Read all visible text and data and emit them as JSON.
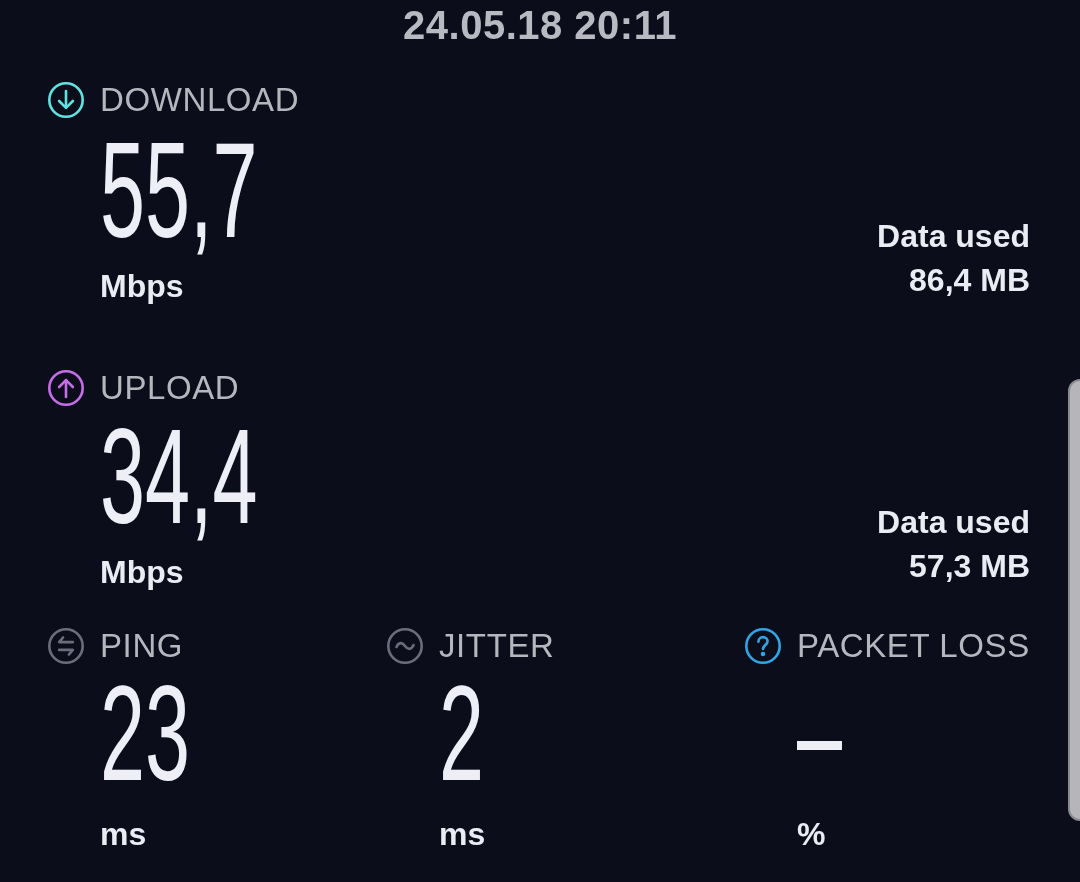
{
  "timestamp": "24.05.18 20:11",
  "transfers": [
    {
      "kind": "download",
      "label": "DOWNLOAD",
      "color": "#5fe3e0",
      "value": "55,7",
      "unit": "Mbps",
      "data_used_label": "Data used",
      "data_used": "86,4 MB"
    },
    {
      "kind": "upload",
      "label": "UPLOAD",
      "color": "#c56ee8",
      "value": "34,4",
      "unit": "Mbps",
      "data_used_label": "Data used",
      "data_used": "57,3 MB"
    }
  ],
  "metrics": [
    {
      "kind": "ping",
      "label": "PING",
      "color": "#6b6c7c",
      "value": "23",
      "unit": "ms"
    },
    {
      "kind": "jitter",
      "label": "JITTER",
      "color": "#6b6c7c",
      "value": "2",
      "unit": "ms"
    },
    {
      "kind": "packet_loss",
      "label": "PACKET LOSS",
      "color": "#2ea6e6",
      "value": "–",
      "unit": "%"
    }
  ]
}
